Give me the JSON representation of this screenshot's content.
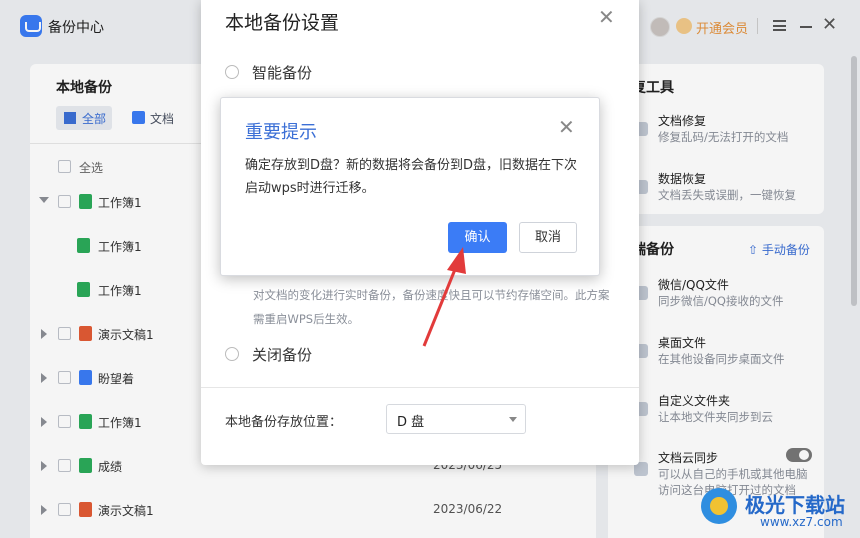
{
  "app": {
    "title": "备份中心",
    "vip_label": "开通会员",
    "close_glyph": "✕"
  },
  "left": {
    "title": "本地备份",
    "filters": {
      "all": "全部",
      "doc": "文档"
    },
    "select_all": "全选",
    "rows": [
      {
        "name": "工作簿1",
        "date": "",
        "type": "sheet",
        "level": 0,
        "chevron": "down"
      },
      {
        "name": "工作簿1",
        "date": "",
        "type": "sheet",
        "level": 1,
        "chevron": ""
      },
      {
        "name": "工作簿1",
        "date": "",
        "type": "sheet",
        "level": 1,
        "chevron": ""
      },
      {
        "name": "演示文稿1",
        "date": "",
        "type": "ppt",
        "level": 0,
        "chevron": "right"
      },
      {
        "name": "盼望着",
        "date": "",
        "type": "word",
        "level": 0,
        "chevron": "right"
      },
      {
        "name": "工作簿1",
        "date": "",
        "type": "sheet",
        "level": 0,
        "chevron": "right"
      },
      {
        "name": "成绩",
        "date": "2023/06/25",
        "type": "sheet",
        "level": 0,
        "chevron": "right"
      },
      {
        "name": "演示文稿1",
        "date": "2023/06/22",
        "type": "ppt",
        "level": 0,
        "chevron": "right"
      }
    ]
  },
  "right": {
    "tools_title": "复工具",
    "tools": [
      {
        "title": "文档修复",
        "desc": "修复乱码/无法打开的文档"
      },
      {
        "title": "数据恢复",
        "desc": "文档丢失或误删，一键恢复"
      }
    ],
    "cloud_title": "端备份",
    "manual_backup": "手动备份",
    "cloud_items": [
      {
        "title": "微信/QQ文件",
        "desc": "同步微信/QQ接收的文件"
      },
      {
        "title": "桌面文件",
        "desc": "在其他设备同步桌面文件"
      },
      {
        "title": "自定义文件夹",
        "desc": "让本地文件夹同步到云"
      },
      {
        "title": "文档云同步",
        "desc": "可以从自己的手机或其他电脑",
        "desc2": "访问这台电脑打开过的文档"
      }
    ]
  },
  "settings_dialog": {
    "title": "本地备份设置",
    "close_glyph": "✕",
    "options": {
      "smart": "智能备份",
      "off": "关闭备份"
    },
    "realtime_desc": "对文档的变化进行实时备份，备份速度快且可以节约存储空间。此方案需重启WPS后生效。",
    "location_label": "本地备份存放位置：",
    "location_value": "D 盘"
  },
  "confirm_dialog": {
    "title": "重要提示",
    "close_glyph": "✕",
    "message": "确定存放到D盘？新的数据将会备份到D盘，旧数据在下次启动wps时进行迁移。",
    "ok_label": "确认",
    "cancel_label": "取消"
  },
  "watermark": {
    "text": "极光下载站",
    "url": "www.xz7.com"
  },
  "colors": {
    "accent": "#3b7cf6",
    "vip": "#e5913b",
    "arrow": "#e23b3b"
  }
}
